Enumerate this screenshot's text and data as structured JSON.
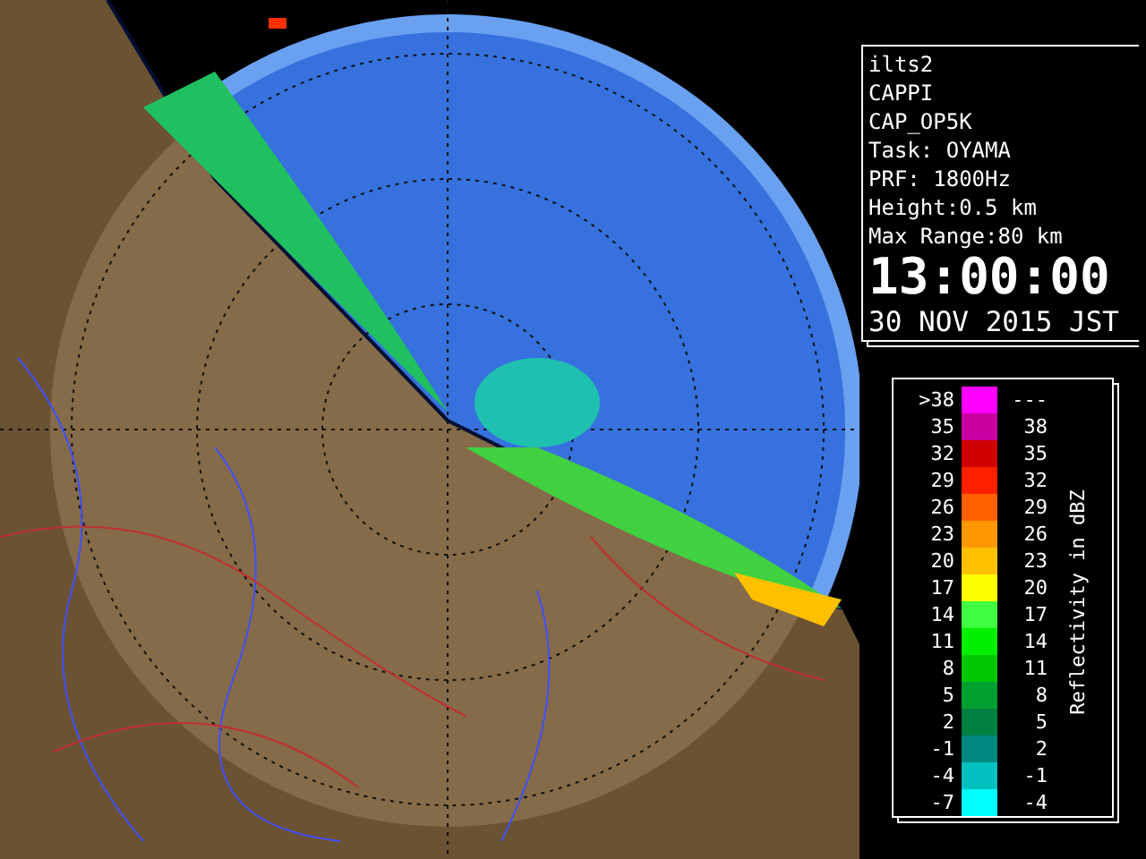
{
  "info": {
    "lines": [
      "ilts2",
      "CAPPI",
      "CAP_OP5K",
      "Task: OYAMA",
      "PRF: 1800Hz",
      "Height:0.5 km",
      "Max Range:80 km"
    ],
    "time": "13:00:00",
    "date": "30 NOV 2015 JST"
  },
  "legend": {
    "title": "Reflectivity in dBZ",
    "rows": [
      {
        "low": ">38",
        "high": "---",
        "color": "#ff00ff"
      },
      {
        "low": "35",
        "high": "38",
        "color": "#c800a0"
      },
      {
        "low": "32",
        "high": "35",
        "color": "#d00000"
      },
      {
        "low": "29",
        "high": "32",
        "color": "#ff2000"
      },
      {
        "low": "26",
        "high": "29",
        "color": "#ff6000"
      },
      {
        "low": "23",
        "high": "26",
        "color": "#ff9800"
      },
      {
        "low": "20",
        "high": "23",
        "color": "#ffc000"
      },
      {
        "low": "17",
        "high": "20",
        "color": "#ffff00"
      },
      {
        "low": "14",
        "high": "17",
        "color": "#40ff40"
      },
      {
        "low": "11",
        "high": "14",
        "color": "#00f000"
      },
      {
        "low": "8",
        "high": "11",
        "color": "#00c800"
      },
      {
        "low": "5",
        "high": "8",
        "color": "#00a030"
      },
      {
        "low": "2",
        "high": "5",
        "color": "#008040"
      },
      {
        "low": "-1",
        "high": "2",
        "color": "#008880"
      },
      {
        "low": "-4",
        "high": "-1",
        "color": "#00c0c0"
      },
      {
        "low": "-7",
        "high": "-4",
        "color": "#00ffff"
      }
    ]
  }
}
